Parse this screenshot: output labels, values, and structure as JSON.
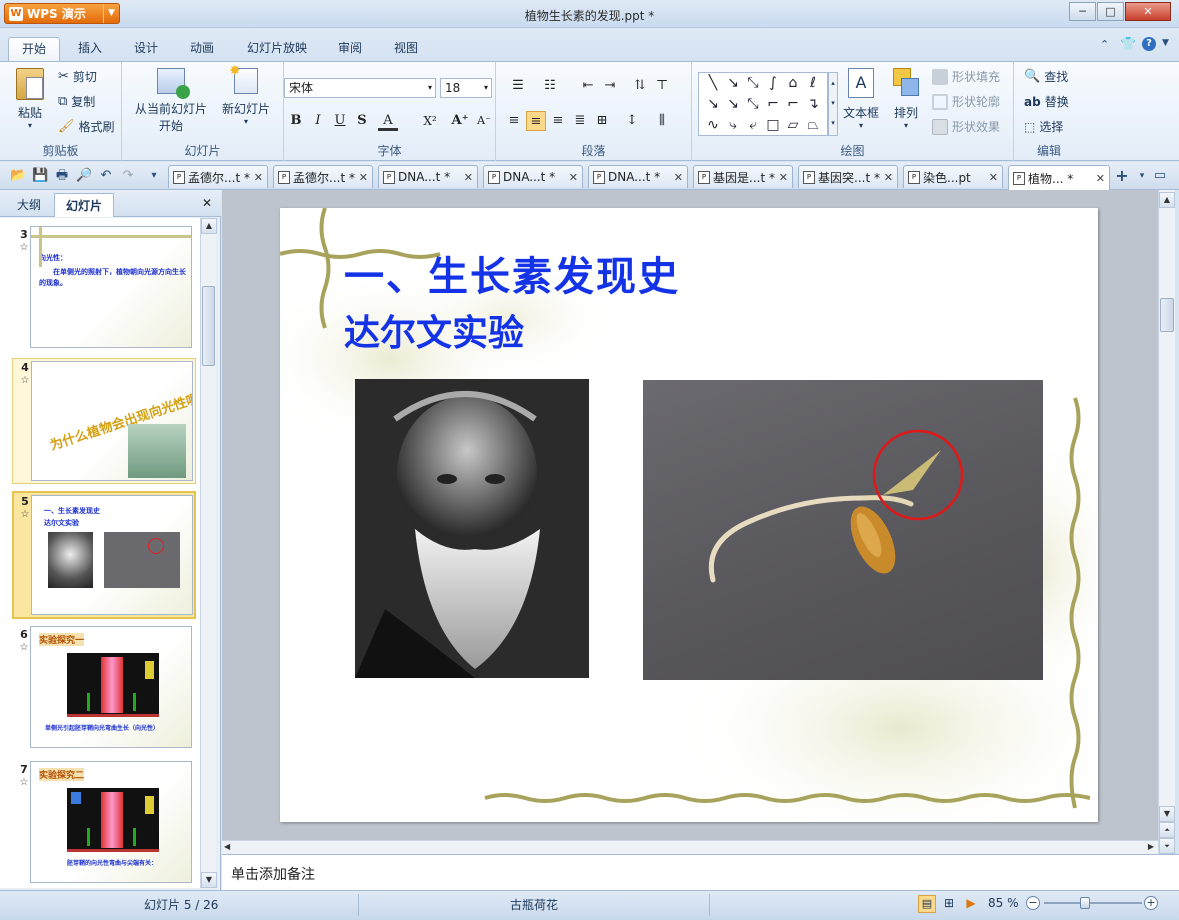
{
  "app": {
    "name": "WPS 演示",
    "window_title": "植物生长素的发现.ppt *"
  },
  "window_controls": {
    "minimize": "─",
    "maximize": "□",
    "close": "✕"
  },
  "ribbon_tabs": [
    "开始",
    "插入",
    "设计",
    "动画",
    "幻灯片放映",
    "审阅",
    "视图"
  ],
  "ribbon": {
    "clipboard": {
      "paste": "粘贴",
      "cut": "剪切",
      "copy": "复制",
      "format_painter": "格式刷",
      "label": "剪贴板"
    },
    "slides": {
      "from_current": "从当前幻灯片",
      "start": "开始",
      "new_slide": "新幻灯片",
      "label": "幻灯片"
    },
    "font": {
      "name": "宋体",
      "size": "18",
      "label": "字体",
      "bold": "B",
      "italic": "I",
      "underline": "U",
      "shadow": "S"
    },
    "paragraph": {
      "label": "段落"
    },
    "drawing": {
      "textbox": "文本框",
      "arrange": "排列",
      "shape_fill": "形状填充",
      "shape_outline": "形状轮廓",
      "shape_effect": "形状效果",
      "label": "绘图"
    },
    "editing": {
      "find": "查找",
      "replace": "替换",
      "select": "选择",
      "label": "编辑"
    }
  },
  "doc_tabs": [
    {
      "label": "孟德尔...t *",
      "active": false
    },
    {
      "label": "孟德尔...t *",
      "active": false
    },
    {
      "label": "DNA...t *",
      "active": false
    },
    {
      "label": "DNA...t *",
      "active": false
    },
    {
      "label": "DNA...t *",
      "active": false
    },
    {
      "label": "基因是...t *",
      "active": false
    },
    {
      "label": "基因突...t *",
      "active": false
    },
    {
      "label": "染色...pt",
      "active": false
    },
    {
      "label": "植物... *",
      "active": true
    }
  ],
  "left_panel": {
    "tab_outline": "大纲",
    "tab_slides": "幻灯片",
    "close": "✕"
  },
  "thumbnails": [
    {
      "num": "3",
      "line1": "向光性：",
      "line2": "在单侧光的照射下，植物朝向光源方向生长的现象。"
    },
    {
      "num": "4",
      "title": "为什么植物会出现向光性呢?"
    },
    {
      "num": "5",
      "title": "一、生长素发现史",
      "subtitle": "达尔文实验",
      "selected": true
    },
    {
      "num": "6",
      "title": "实验探究一",
      "caption": "单侧光引起胚芽鞘向光弯曲生长（向光性）"
    },
    {
      "num": "7",
      "title": "实验探究二",
      "caption": "胚芽鞘的向光性弯曲与尖端有关："
    }
  ],
  "slide": {
    "title": "一、生长素发现史",
    "subtitle": "达尔文实验"
  },
  "notes": {
    "placeholder": "单击添加备注"
  },
  "status": {
    "slide_info": "幻灯片 5 / 26",
    "theme": "古瓶荷花",
    "zoom": "85 %"
  }
}
